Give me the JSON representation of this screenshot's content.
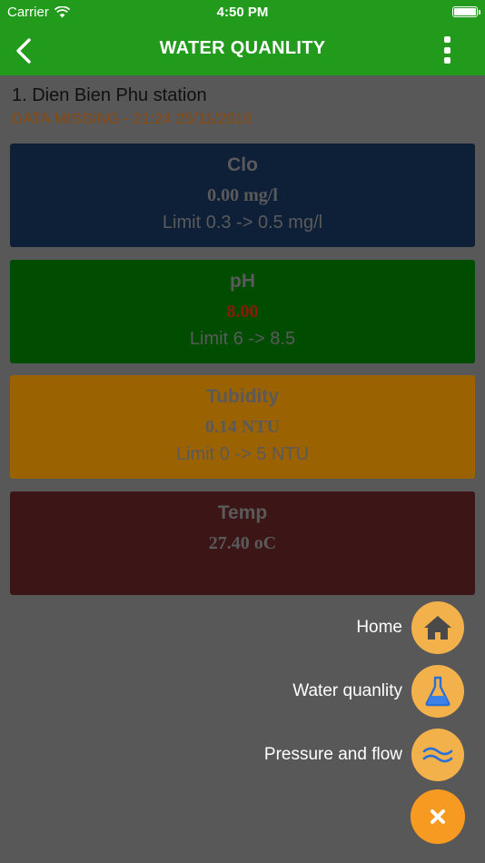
{
  "status_bar": {
    "carrier": "Carrier",
    "time": "4:50 PM",
    "battery_level": 1.0
  },
  "nav": {
    "title": "WATER QUANLITY",
    "back_icon": "chevron-left-icon",
    "menu_icon": "more-vertical-icon"
  },
  "station": {
    "name": "1. Dien Bien Phu station",
    "status": "DATA MISSING - 21:24 25/11/2016"
  },
  "cards": [
    {
      "name": "Clo",
      "value": "0.00 mg/l",
      "limit": "Limit 0.3 -> 0.5 mg/l",
      "color": "#0e2038"
    },
    {
      "name": "pH",
      "value": "8.00",
      "limit": "Limit 6 -> 8.5",
      "color": "#004c00",
      "value_color": "#8a1a0a"
    },
    {
      "name": "Tubidity",
      "value": "0.14 NTU",
      "limit": "Limit 0 -> 5 NTU",
      "color": "#9a6200"
    },
    {
      "name": "Temp",
      "value": "27.40 oC",
      "limit": "",
      "color": "#3c1616"
    }
  ],
  "fab_menu": {
    "items": [
      {
        "label": "Home",
        "icon": "home-icon"
      },
      {
        "label": "Water quanlity",
        "icon": "flask-icon"
      },
      {
        "label": "Pressure and flow",
        "icon": "waves-icon"
      }
    ],
    "close_icon": "close-icon"
  },
  "colors": {
    "brand_green": "#229a1c",
    "overlay_gray": "#585858",
    "fab_orange": "#f79a22",
    "fab_light_orange": "#f3b14c"
  }
}
